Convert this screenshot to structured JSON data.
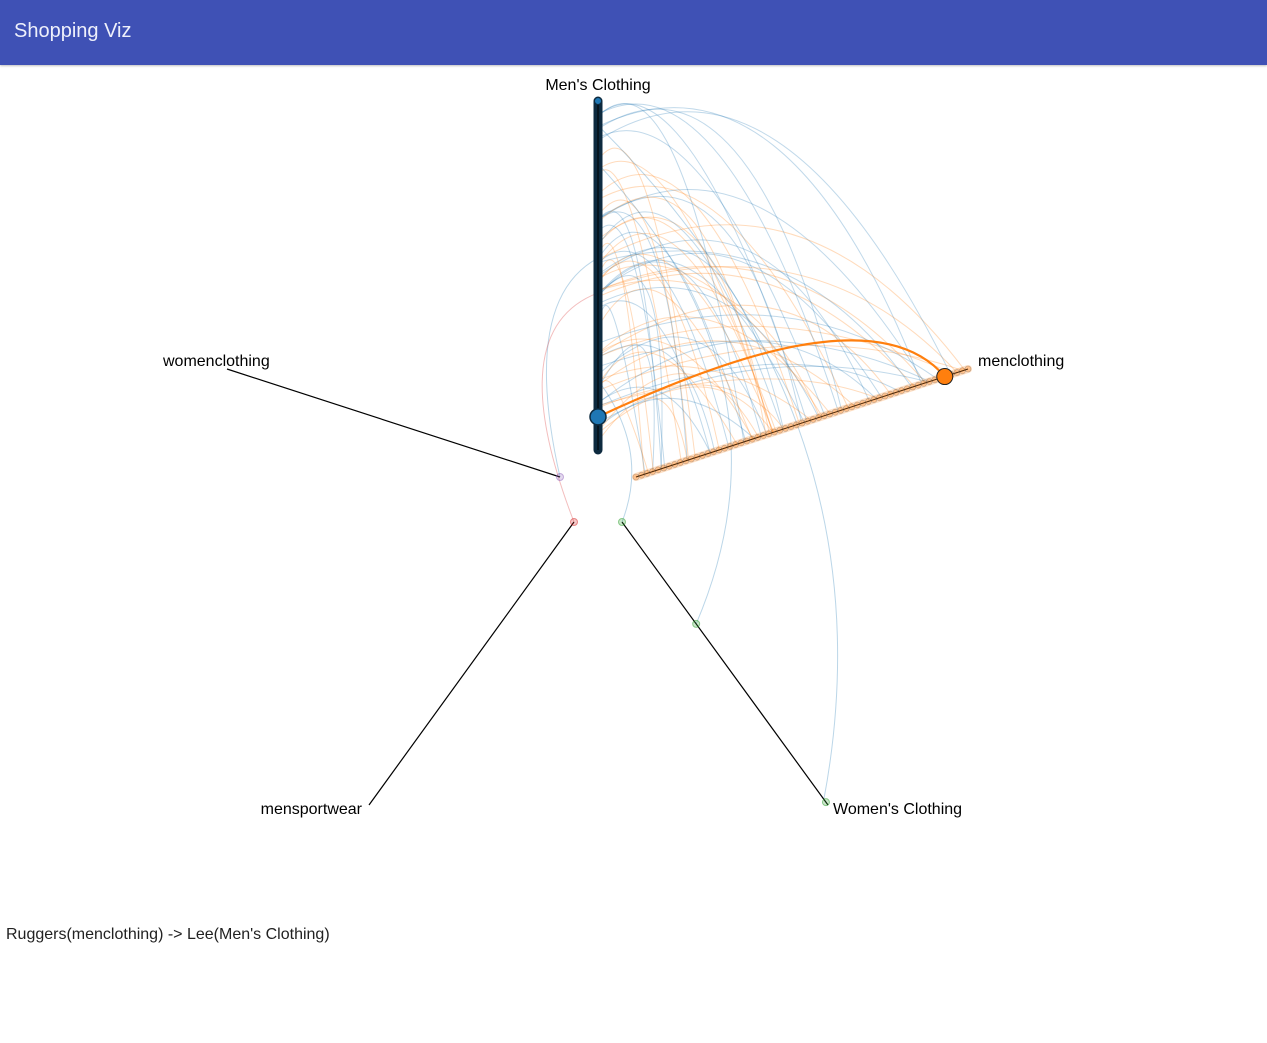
{
  "app": {
    "title": "Shopping Viz"
  },
  "chart_data": {
    "type": "hive-plot",
    "axes": [
      {
        "id": "mens-clothing",
        "label": "Men's Clothing",
        "color": "#1f77b4"
      },
      {
        "id": "menclothing",
        "label": "menclothing",
        "color": "#ff7f0e"
      },
      {
        "id": "womens-clothing",
        "label": "Women's Clothing",
        "color": "#2ca02c"
      },
      {
        "id": "mensportwear",
        "label": "mensportwear",
        "color": "#d62728"
      },
      {
        "id": "womenclothing",
        "label": "womenclothing",
        "color": "#9467bd"
      }
    ],
    "highlight": {
      "source": "Ruggers",
      "source_category": "menclothing",
      "target": "Lee",
      "target_category": "Men's Clothing",
      "color": "#ff7f0e"
    }
  },
  "status": {
    "text": "Ruggers(menclothing) -> Lee(Men's Clothing)"
  }
}
